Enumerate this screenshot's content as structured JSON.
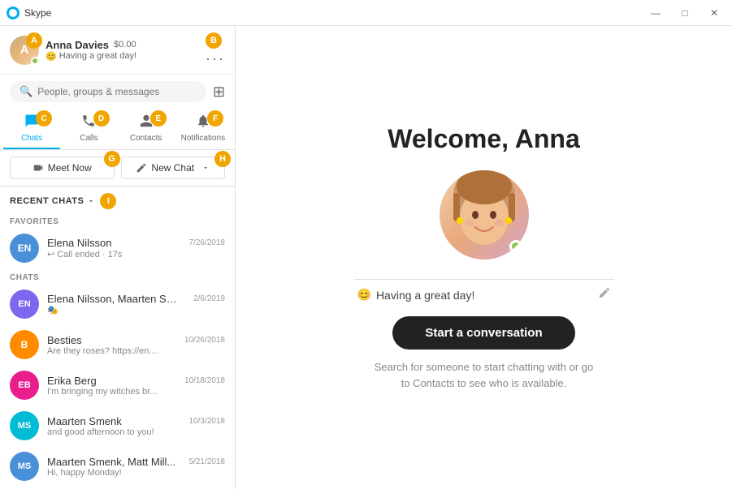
{
  "window": {
    "title": "Skype",
    "controls": {
      "minimize": "—",
      "maximize": "□",
      "close": "✕"
    }
  },
  "profile": {
    "name": "Anna Davies",
    "balance": "$0.00",
    "status_emoji": "😊",
    "status_text": "Having a great day!",
    "badge_a": "A",
    "badge_b": "B"
  },
  "search": {
    "placeholder": "People, groups & messages"
  },
  "nav": {
    "tabs": [
      {
        "id": "chats",
        "label": "Chats",
        "icon": "💬",
        "active": true,
        "badge": "C"
      },
      {
        "id": "calls",
        "label": "Calls",
        "icon": "📞",
        "active": false,
        "badge": "D"
      },
      {
        "id": "contacts",
        "label": "Contacts",
        "icon": "👤",
        "active": false,
        "badge": "E"
      },
      {
        "id": "notifications",
        "label": "Notifications",
        "icon": "🔔",
        "active": false,
        "badge": "F"
      }
    ]
  },
  "actions": {
    "meet_now": "Meet Now",
    "new_chat": "New Chat",
    "badge_g": "G",
    "badge_h": "H"
  },
  "section": {
    "recent_chats": "RECENT CHATS",
    "badge_i": "I",
    "favorites_label": "FAVORITES",
    "chats_label": "CHATS"
  },
  "favorites": [
    {
      "name": "Elena Nilsson",
      "date": "7/26/2018",
      "preview": "Call ended · 17s",
      "preview_icon": "↩",
      "initials": "EN",
      "color": "blue"
    }
  ],
  "chats": [
    {
      "name": "Elena Nilsson, Maarten Sm...",
      "date": "2/6/2019",
      "preview": "🎭",
      "preview_icon": "",
      "initials": "EN",
      "color": "purple"
    },
    {
      "name": "Besties",
      "date": "10/26/2018",
      "preview": "Are they roses? https://en....",
      "preview_icon": "",
      "initials": "B",
      "color": "orange"
    },
    {
      "name": "Erika Berg",
      "date": "10/18/2018",
      "preview": "I'm bringing my witches br...",
      "preview_icon": "",
      "initials": "EB",
      "color": "pink"
    },
    {
      "name": "Maarten Smenk",
      "date": "10/3/2018",
      "preview": "and good afternoon to you!",
      "preview_icon": "",
      "initials": "MS",
      "color": "teal"
    },
    {
      "name": "Maarten Smenk, Matt Mill...",
      "date": "5/21/2018",
      "preview": "Hi, happy Monday!",
      "preview_icon": "",
      "initials": "MS",
      "color": "blue"
    }
  ],
  "main": {
    "welcome": "Welcome, Anna",
    "status_emoji": "😊",
    "status_text": "Having a great day!",
    "start_btn": "Start a conversation",
    "description": "Search for someone to start chatting with or go to Contacts to see who is available."
  }
}
